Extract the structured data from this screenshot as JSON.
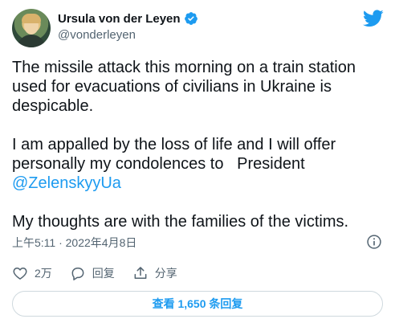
{
  "tweet": {
    "author_name": "Ursula von der Leyen",
    "author_handle": "@vonderleyen",
    "paragraphs": {
      "p1": "The missile attack this morning on a train station used for evacuations of civilians in Ukraine is despicable.",
      "p2_prefix": "I am appalled by the loss of life and I will offer personally my condolences to   President ",
      "p2_mention": "@ZelenskyyUa",
      "p3": "My thoughts are with the families of the victims."
    },
    "timestamp": "上午5:11 · 2022年4月8日"
  },
  "actions": {
    "like_count": "2万",
    "reply_label": "回复",
    "share_label": "分享"
  },
  "replies_button_label": "查看 1,650 条回复",
  "icons": [
    "verified-badge-icon",
    "twitter-bird-icon",
    "info-icon",
    "heart-icon",
    "reply-bubble-icon",
    "share-icon"
  ],
  "colors": {
    "accent": "#1d9bf0",
    "text": "#0f1419",
    "secondary": "#536471",
    "border": "#cfd9de"
  }
}
